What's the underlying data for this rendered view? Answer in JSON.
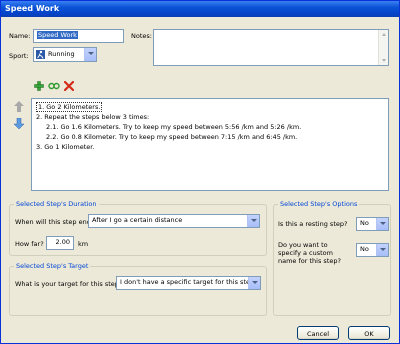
{
  "window": {
    "title": "Speed Work"
  },
  "form": {
    "name_label": "Name:",
    "name_value": "Speed Work",
    "notes_label": "Notes:",
    "sport_label": "Sport:",
    "sport_value": "Running"
  },
  "toolbar": {
    "add_icon": "plus-icon",
    "repeat_icon": "repeat-icon",
    "delete_icon": "delete-icon",
    "move_up_icon": "arrow-up-icon",
    "move_down_icon": "arrow-down-icon"
  },
  "steps": [
    {
      "text": "1. Go 2 Kilometers.",
      "indent": 0,
      "selected": true
    },
    {
      "text": "2. Repeat the steps below 3 times:",
      "indent": 0,
      "selected": false
    },
    {
      "text": "2.1. Go 1.6 Kilometers. Try to keep my speed between 5:56 /km and 5:26 /km.",
      "indent": 1,
      "selected": false
    },
    {
      "text": "2.2. Go 0.8 Kilometer. Try to keep my speed between 7:15 /km and 6:45 /km.",
      "indent": 1,
      "selected": false
    },
    {
      "text": "3. Go 1 Kilometer.",
      "indent": 0,
      "selected": false
    }
  ],
  "duration": {
    "title": "Selected Step's Duration",
    "end_label": "When will this step end?",
    "end_value": "After I go a certain distance",
    "far_label": "How far?",
    "far_value": "2.00",
    "far_unit": "km"
  },
  "target": {
    "title": "Selected Step's Target",
    "question": "What is your target for this step?",
    "value": "I don't have a specific target for this step"
  },
  "options": {
    "title": "Selected Step's Options",
    "resting_label": "Is this a resting step?",
    "resting_value": "No",
    "custom_name_label": "Do you want to specify a custom name for this step?",
    "custom_name_value": "No"
  },
  "buttons": {
    "cancel": "Cancel",
    "ok": "OK"
  },
  "colors": {
    "title_bar": "#0a53d6",
    "group_title": "#0046d5",
    "window_bg": "#ece9d8"
  }
}
